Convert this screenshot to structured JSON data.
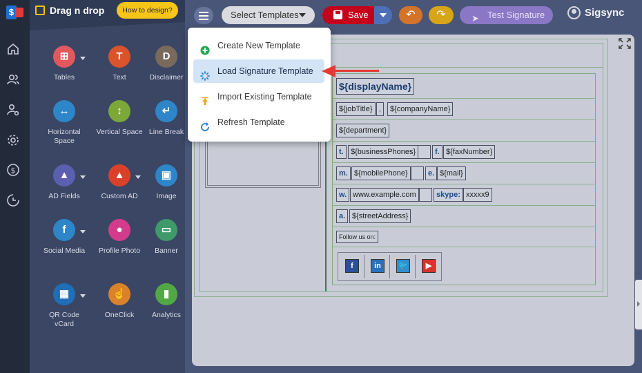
{
  "sidebar": {
    "title": "Drag n drop",
    "help_button": "How to design?",
    "tools": [
      {
        "label": "Tables",
        "glyph": "⊞",
        "color": "#e2585d",
        "has_menu": true
      },
      {
        "label": "Text",
        "glyph": "T",
        "color": "#d9532b",
        "has_menu": false
      },
      {
        "label": "Disclaimer",
        "glyph": "D",
        "color": "#7a6a5c",
        "has_menu": false
      },
      {
        "label": "Horizontal Space",
        "glyph": "↔",
        "color": "#2e86c9",
        "has_menu": false
      },
      {
        "label": "Vertical Space",
        "glyph": "↕",
        "color": "#7ca83a",
        "has_menu": false
      },
      {
        "label": "Line Break",
        "glyph": "↵",
        "color": "#2e86c9",
        "has_menu": false
      },
      {
        "label": "AD Fields",
        "glyph": "▲",
        "color": "#5b5fb0",
        "has_menu": true
      },
      {
        "label": "Custom AD",
        "glyph": "▲",
        "color": "#d9412b",
        "has_menu": true
      },
      {
        "label": "Image",
        "glyph": "▣",
        "color": "#2e86c9",
        "has_menu": false
      },
      {
        "label": "Social Media",
        "glyph": "f",
        "color": "#2e86c9",
        "has_menu": true
      },
      {
        "label": "Profile Photo",
        "glyph": "●",
        "color": "#d33c8c",
        "has_menu": false
      },
      {
        "label": "Banner",
        "glyph": "▭",
        "color": "#3f9a6a",
        "has_menu": false
      },
      {
        "label": "QR Code vCard",
        "glyph": "▦",
        "color": "#1f6fb8",
        "has_menu": true
      },
      {
        "label": "OneClick",
        "glyph": "☝",
        "color": "#d9822b",
        "has_menu": false
      },
      {
        "label": "Analytics",
        "glyph": "▮",
        "color": "#52a845",
        "has_menu": false
      }
    ]
  },
  "toolbar": {
    "select_templates": "Select Templates",
    "save": "Save",
    "undo_glyph": "↶",
    "redo_glyph": "↷",
    "test_signature": "Test Signature",
    "test_glyph": "➤",
    "brand": "Sigsync"
  },
  "menu": {
    "items": [
      {
        "label": "Create New Template",
        "icon": "plus-circle-icon"
      },
      {
        "label": "Load Signature Template",
        "icon": "loading-spinner-icon",
        "highlighted": true
      },
      {
        "label": "Import Existing Template",
        "icon": "upload-icon"
      },
      {
        "label": "Refresh Template",
        "icon": "refresh-icon"
      }
    ]
  },
  "signature": {
    "display_name": "${displayName}",
    "job_title": "${jobTitle}",
    "comma": ",",
    "company": "${companyName}",
    "department": "${department}",
    "t_label": "t.",
    "business_phones": "${businessPhones}",
    "f_label": "f.",
    "fax": "${faxNumber}",
    "m_label": "m.",
    "mobile": "${mobilePhone}",
    "e_label": "e.",
    "mail": "${mail}",
    "w_label": "w.",
    "website": "www.example.com",
    "skype_label": "skype:",
    "skype": "xxxxx9",
    "a_label": "a.",
    "address": "${streetAddress}",
    "follow": "Follow us on:",
    "social_icons": [
      {
        "glyph": "f",
        "name": "facebook",
        "color": "#2d4f96"
      },
      {
        "glyph": "in",
        "name": "linkedin",
        "color": "#2a71b7"
      },
      {
        "glyph": "🐦",
        "name": "twitter",
        "color": "#2f8fd0"
      },
      {
        "glyph": "▶",
        "name": "youtube",
        "color": "#d9332b"
      }
    ]
  }
}
